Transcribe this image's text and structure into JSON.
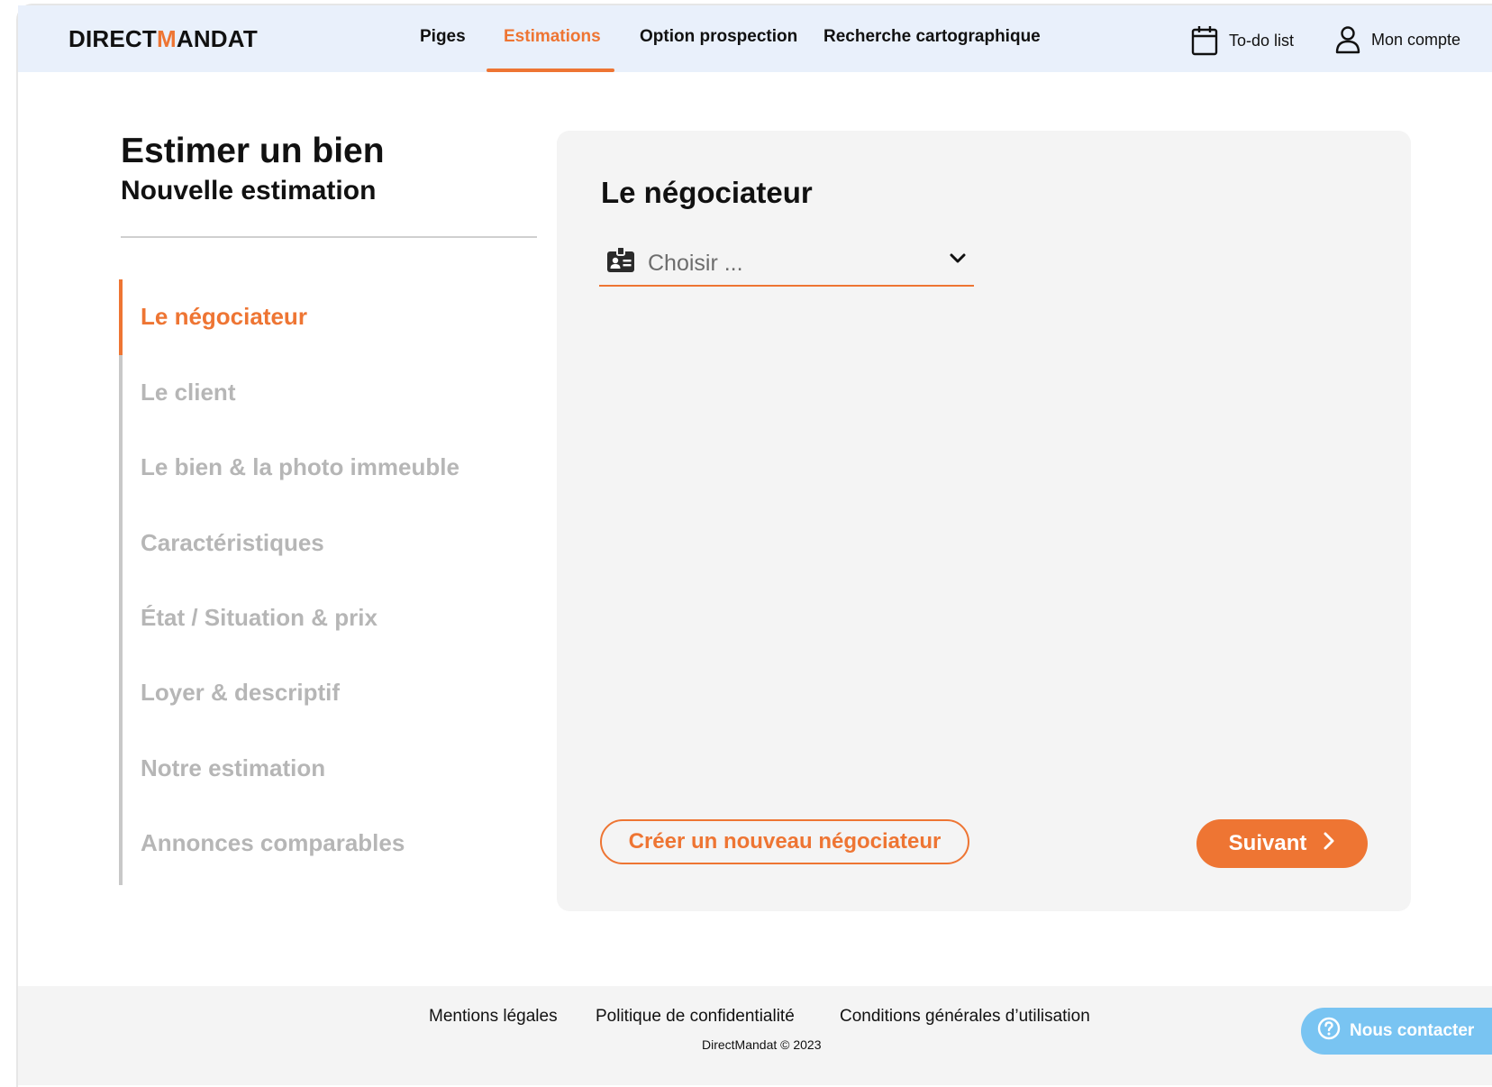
{
  "brand": {
    "logo_prefix": "DIRECT",
    "logo_accent": "M",
    "logo_suffix": "ANDAT",
    "accent_color": "#ee7533"
  },
  "nav": {
    "items": [
      {
        "label": "Piges"
      },
      {
        "label": "Estimations",
        "active": true
      },
      {
        "label": "Option prospection"
      },
      {
        "label": "Recherche cartographique"
      }
    ],
    "todo_label": "To-do list",
    "account_label": "Mon compte"
  },
  "page": {
    "title": "Estimer un bien",
    "subtitle": "Nouvelle estimation"
  },
  "steps": [
    {
      "label": "Le négociateur",
      "active": true
    },
    {
      "label": "Le client"
    },
    {
      "label": "Le bien & la photo immeuble"
    },
    {
      "label": "Caractéristiques"
    },
    {
      "label": "État / Situation & prix"
    },
    {
      "label": "Loyer & descriptif"
    },
    {
      "label": "Notre estimation"
    },
    {
      "label": "Annonces comparables"
    }
  ],
  "form": {
    "section_title": "Le négociateur",
    "select_placeholder": "Choisir ...",
    "create_button": "Créer un nouveau négociateur",
    "next_button": "Suivant"
  },
  "footer": {
    "links": [
      "Mentions légales",
      "Politique de confidentialité",
      "Conditions générales d’utilisation"
    ],
    "copyright": "DirectMandat © 2023",
    "contact_label": "Nous contacter"
  }
}
